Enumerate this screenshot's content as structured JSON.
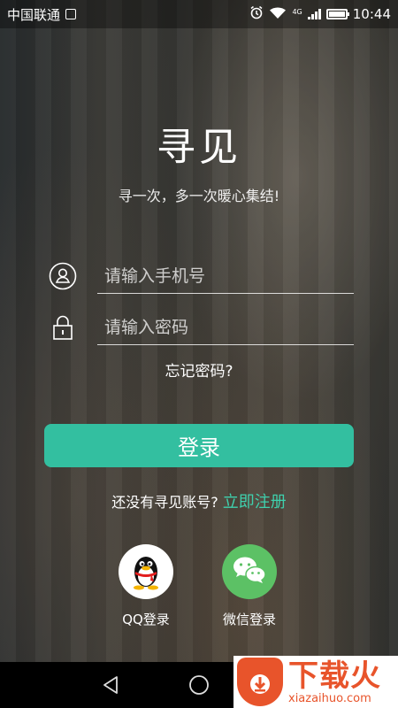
{
  "status_bar": {
    "carrier": "中国联通",
    "network_type": "4G",
    "time": "10:44"
  },
  "app": {
    "title": "寻见",
    "subtitle": "寻一次，多一次暖心集结!"
  },
  "form": {
    "phone_placeholder": "请输入手机号",
    "password_placeholder": "请输入密码",
    "forgot_label": "忘记密码?",
    "login_label": "登录"
  },
  "register": {
    "prompt": "还没有寻见账号?",
    "link_label": "立即注册"
  },
  "social": {
    "qq_label": "QQ登录",
    "wechat_label": "微信登录"
  },
  "watermark": {
    "text": "下载火",
    "url": "xiazaihuo.com"
  },
  "colors": {
    "accent": "#33bfa0",
    "link": "#3fd0ad",
    "wechat": "#5cc165",
    "watermark": "#e8542b"
  }
}
